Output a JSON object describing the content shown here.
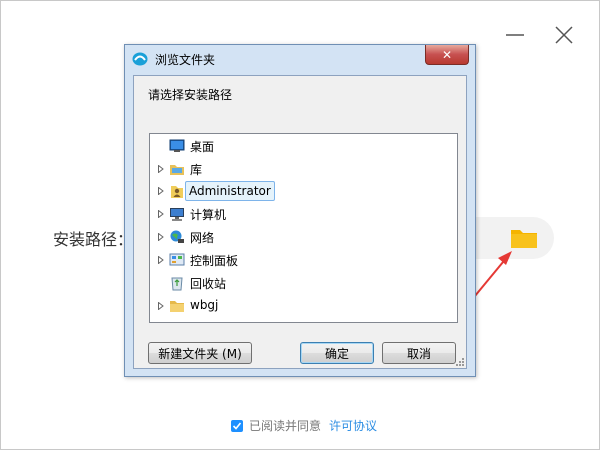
{
  "installer": {
    "install_path_label": "安装路径：",
    "agree_prefix": "已阅读并同意",
    "license_link": "许可协议",
    "agree_checked": true,
    "accent_color": "#1e90ff",
    "folder_icon": "folder-icon",
    "minimize_icon": "minimize-icon",
    "close_icon": "close-icon"
  },
  "dialog": {
    "title": "浏览文件夹",
    "prompt": "请选择安装路径",
    "close_glyph": "✕",
    "tree": [
      {
        "label": "桌面",
        "icon": "desktop-icon",
        "expandable": false,
        "selected": false
      },
      {
        "label": "库",
        "icon": "library-icon",
        "expandable": true,
        "selected": false
      },
      {
        "label": "Administrator",
        "icon": "user-folder-icon",
        "expandable": true,
        "selected": true
      },
      {
        "label": "计算机",
        "icon": "computer-icon",
        "expandable": true,
        "selected": false
      },
      {
        "label": "网络",
        "icon": "network-icon",
        "expandable": true,
        "selected": false
      },
      {
        "label": "控制面板",
        "icon": "control-panel-icon",
        "expandable": true,
        "selected": false
      },
      {
        "label": "回收站",
        "icon": "recycle-bin-icon",
        "expandable": false,
        "selected": false
      },
      {
        "label": "wbgj",
        "icon": "folder-icon",
        "expandable": true,
        "selected": false
      }
    ],
    "buttons": {
      "new_folder": "新建文件夹 (M)",
      "ok": "确定",
      "cancel": "取消"
    }
  }
}
